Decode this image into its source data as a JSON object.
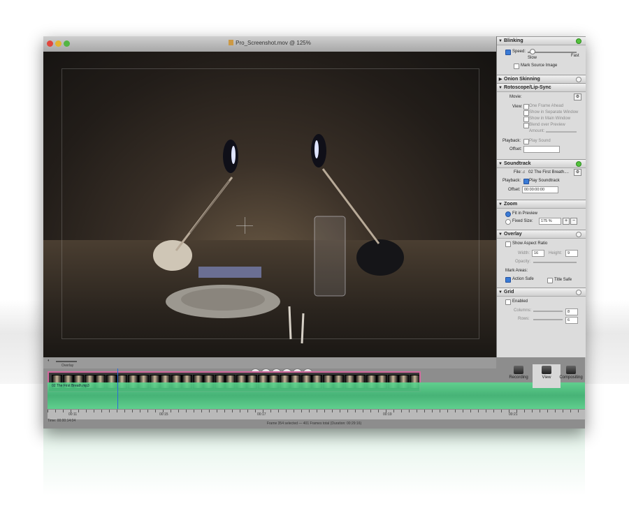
{
  "window": {
    "title": "Pro_Screenshot.mov @ 125%"
  },
  "viewer": {
    "description_icon": "video-frame"
  },
  "transport": {
    "onion_label": "Overlay",
    "buttons": [
      "⏮",
      "◀◀",
      "●",
      "▶",
      "▶▶",
      "⏭"
    ]
  },
  "timeline": {
    "clip_name": "02 The First Breath.mp3",
    "ruler_labels": [
      "00:11",
      "00:15",
      "00:17",
      "00:19",
      "00:21"
    ],
    "time_display": "Time: 00:00:14:04",
    "status": "Frame 354 selected — 401 Frames total (Duration: 00:29:16)"
  },
  "right_tools": [
    {
      "label": "Recording",
      "icon": "clapper-icon"
    },
    {
      "label": "View",
      "icon": "view-icon"
    },
    {
      "label": "Compositing",
      "icon": "stack-icon"
    }
  ],
  "panel": {
    "blinking": {
      "title": "Blinking",
      "speed_label": "Speed:",
      "slow": "Slow",
      "fast": "Fast",
      "mark_source": "Mark Source Image"
    },
    "onion": {
      "title": "Onion Skinning"
    },
    "roto": {
      "title": "Rotoscope/Lip-Sync",
      "movie_label": "Movie:",
      "view_label": "View:",
      "opt1": "One Frame Ahead",
      "opt2": "Show in Separate Window",
      "opt3": "Show in Main Window",
      "opt4": "Blend over Preview",
      "amount_label": "Amount:",
      "playback_label": "Playback:",
      "play_sound": "Play Sound",
      "offset_label": "Offset:"
    },
    "soundtrack": {
      "title": "Soundtrack",
      "file_label": "File:",
      "file_value": "02 The First Breath....",
      "playback_label": "Playback:",
      "play_soundtrack": "Play Soundtrack",
      "offset_label": "Offset:",
      "offset_value": "00:00:00:00"
    },
    "zoom": {
      "title": "Zoom",
      "fit": "Fit in Preview",
      "fixed": "Fixed Size:",
      "fixed_value": "175 %",
      "plus": "+",
      "minus": "−"
    },
    "overlay": {
      "title": "Overlay",
      "aspect": "Show Aspect Ratio",
      "width_label": "Width:",
      "width_value": "16",
      "height_label": "Height:",
      "height_value": "9",
      "opacity_label": "Opacity:",
      "mark_areas": "Mark Areas:",
      "action_safe": "Action Safe",
      "title_safe": "Title Safe"
    },
    "grid": {
      "title": "Grid",
      "enabled": "Enabled",
      "columns_label": "Columns:",
      "columns_value": "8",
      "rows_label": "Rows:",
      "rows_value": "6"
    }
  }
}
